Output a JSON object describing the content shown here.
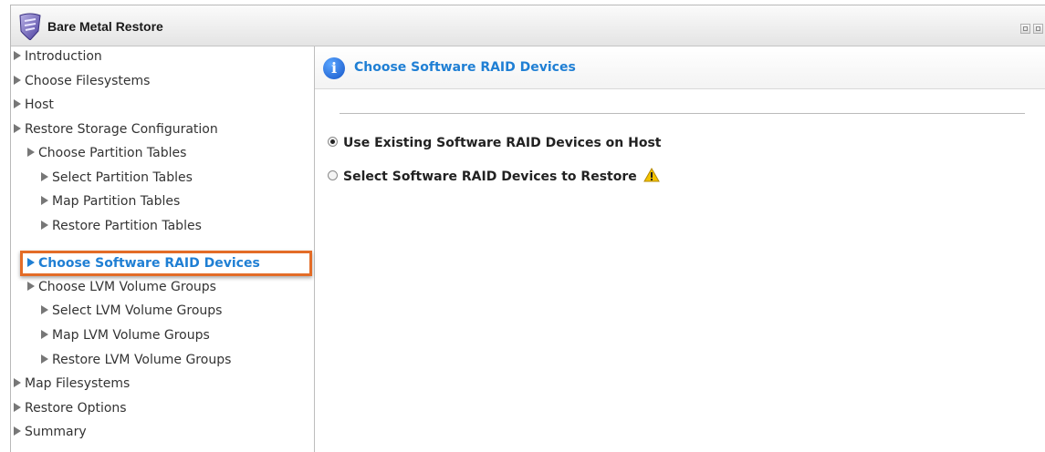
{
  "window": {
    "title": "Bare Metal Restore"
  },
  "sidebar": {
    "items": [
      {
        "label": "Introduction"
      },
      {
        "label": "Choose Filesystems"
      },
      {
        "label": "Host"
      },
      {
        "label": "Restore Storage Configuration"
      },
      {
        "label": "Choose Partition Tables"
      },
      {
        "label": "Select Partition Tables"
      },
      {
        "label": "Map Partition Tables"
      },
      {
        "label": "Restore Partition Tables"
      },
      {
        "label": "Choose Software RAID Devices",
        "active": true
      },
      {
        "label": "Choose LVM Volume Groups"
      },
      {
        "label": "Select LVM Volume Groups"
      },
      {
        "label": "Map LVM Volume Groups"
      },
      {
        "label": "Restore LVM Volume Groups"
      },
      {
        "label": "Map Filesystems"
      },
      {
        "label": "Restore Options"
      },
      {
        "label": "Summary"
      }
    ]
  },
  "main": {
    "header_icon": "info-icon",
    "title": "Choose Software RAID Devices",
    "options": [
      {
        "label": "Use Existing Software RAID Devices on Host",
        "selected": true
      },
      {
        "label": "Select Software RAID Devices to Restore",
        "selected": false,
        "icon": "warning-icon"
      }
    ]
  },
  "colors": {
    "accent": "#1f7fd4",
    "highlight_border": "#e36c27",
    "warning": "#f2c200"
  }
}
